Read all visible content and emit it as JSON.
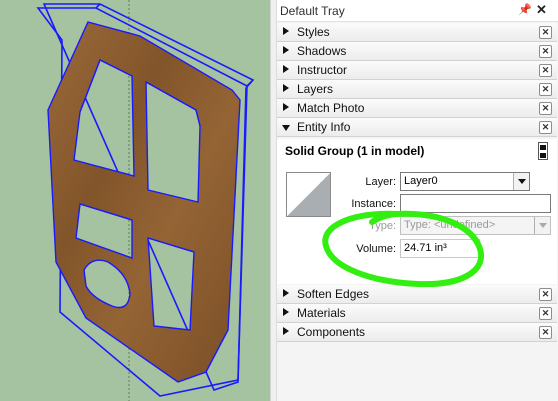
{
  "tray": {
    "title": "Default Tray",
    "pin_icon": "pin-icon",
    "close_icon": "close-icon"
  },
  "panels": [
    {
      "label": "Styles",
      "expanded": false
    },
    {
      "label": "Shadows",
      "expanded": false
    },
    {
      "label": "Instructor",
      "expanded": false
    },
    {
      "label": "Layers",
      "expanded": false
    },
    {
      "label": "Match Photo",
      "expanded": false
    },
    {
      "label": "Entity Info",
      "expanded": true
    },
    {
      "label": "Soften Edges",
      "expanded": false
    },
    {
      "label": "Materials",
      "expanded": false
    },
    {
      "label": "Components",
      "expanded": false
    }
  ],
  "entity_info": {
    "title": "Solid Group (1 in model)",
    "layer_label": "Layer:",
    "layer_value": "Layer0",
    "instance_label": "Instance:",
    "instance_value": "",
    "type_label": "Type:",
    "type_value": "Type: <undefined>",
    "volume_label": "Volume:",
    "volume_value": "24.71 in³"
  },
  "colors": {
    "viewport_bg": "#a5c3a1",
    "model_wood": "#8b5a2b",
    "selection_edges": "#1a1aff",
    "highlight_marker": "#33ee11"
  }
}
